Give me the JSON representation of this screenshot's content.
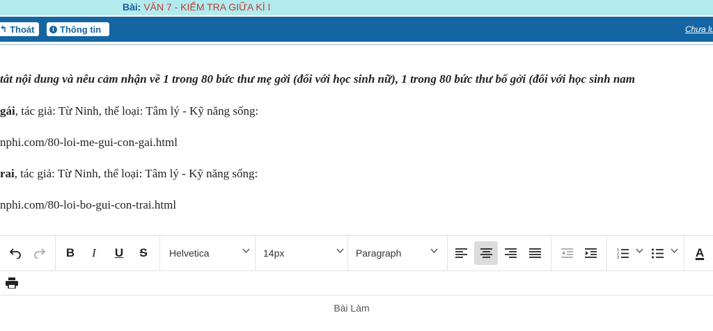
{
  "header": {
    "title_prefix": "Bài:",
    "title_value": "VĂN 7 - KIỂM TRA GIỮA KÌ I"
  },
  "nav": {
    "exit_label": "Thoát",
    "info_label": "Thông tin",
    "right_link": "Chưa lưu"
  },
  "content": {
    "question": "tắt nội dung và nêu cảm nhận về 1 trong 80 bức thư mẹ gởi (đối với học sinh nữ), 1 trong 80 bức thư bố gởi (đối với học sinh nam",
    "line2_bold": "gái",
    "line2_rest": ", tác giả: Từ Ninh, thể loại: Tâm lý - Kỹ năng sống:",
    "line3": "nphi.com/80-loi-me-gui-con-gai.html",
    "line4_bold": "rai",
    "line4_rest": ", tác giả: Từ Ninh, thể loại: Tâm lý - Kỹ năng sống:",
    "line5": "nphi.com/80-loi-bo-gui-con-trai.html"
  },
  "toolbar": {
    "font_family": "Helvetica",
    "font_size": "14px",
    "block_format": "Paragraph",
    "bold_label": "B",
    "italic_label": "I",
    "underline_label": "U",
    "strike_label": "S",
    "text_color_label": "A"
  },
  "editor": {
    "footer_label": "Bài Làm"
  }
}
